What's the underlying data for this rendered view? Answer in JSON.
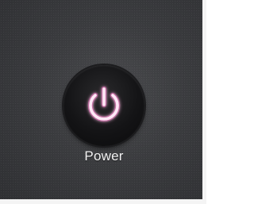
{
  "power": {
    "label": "Power",
    "icon": "power-icon",
    "glow_color": "#ffd6f0",
    "glow_color_outer": "#e85ab6"
  }
}
